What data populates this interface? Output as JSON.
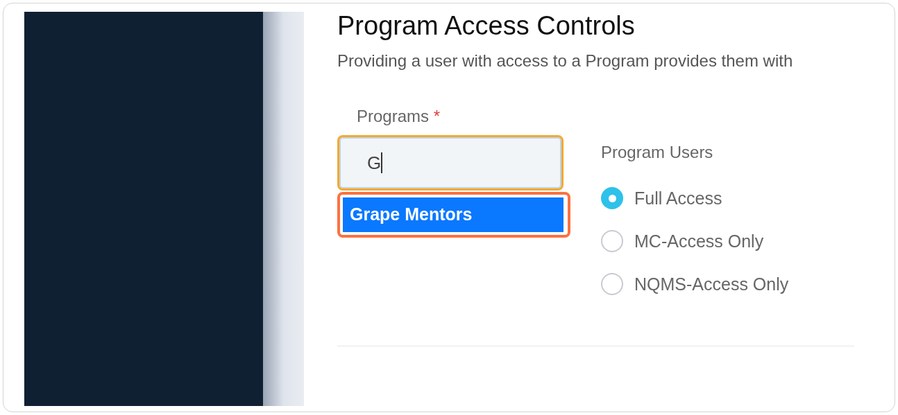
{
  "heading": "Program Access Controls",
  "description": "Providing a user with access to a Program provides them with",
  "programs_field": {
    "label": "Programs",
    "required_mark": "*",
    "value": "G",
    "focused": true
  },
  "suggestions": [
    {
      "label": "Grape Mentors",
      "selected": true
    }
  ],
  "program_users": {
    "label": "Program Users",
    "options": [
      {
        "label": "Full Access",
        "selected": true
      },
      {
        "label": "MC-Access Only",
        "selected": false
      },
      {
        "label": "NQMS-Access Only",
        "selected": false
      }
    ]
  }
}
